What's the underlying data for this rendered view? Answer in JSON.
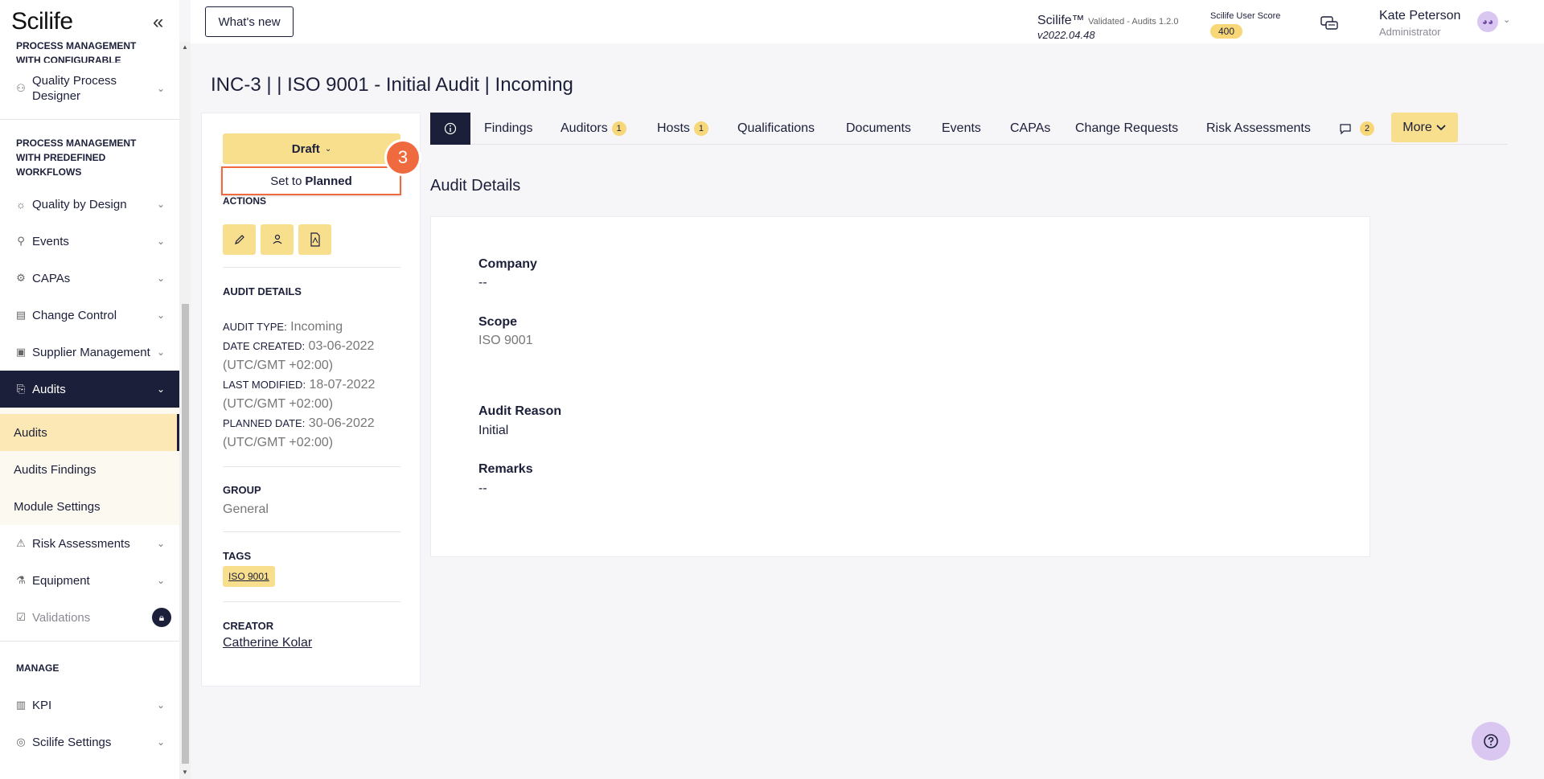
{
  "app": {
    "logo": "Scilife"
  },
  "topbar": {
    "whats_new": "What's new",
    "product": "Scilife™",
    "validated": "Validated - Audits 1.2.0",
    "version": "v2022.04.48",
    "score_label": "Scilife User Score",
    "score_value": "400",
    "user_name": "Kate Peterson",
    "user_role": "Administrator"
  },
  "sidebar": {
    "section_configurable": "PROCESS MANAGEMENT WITH CONFIGURABLE WORKFLOWS",
    "quality_process_designer": "Quality Process Designer",
    "section_predefined": "PROCESS MANAGEMENT WITH PREDEFINED WORKFLOWS",
    "items": [
      {
        "label": "Quality by Design",
        "icon": "lightbulb-icon"
      },
      {
        "label": "Events",
        "icon": "pin-icon"
      },
      {
        "label": "CAPAs",
        "icon": "capa-icon"
      },
      {
        "label": "Change Control",
        "icon": "change-icon"
      },
      {
        "label": "Supplier Management",
        "icon": "box-icon"
      },
      {
        "label": "Audits",
        "icon": "audit-icon"
      }
    ],
    "subitems": [
      "Audits",
      "Audits Findings",
      "Module Settings"
    ],
    "items2": [
      {
        "label": "Risk Assessments",
        "icon": "warning-icon"
      },
      {
        "label": "Equipment",
        "icon": "flask-icon"
      },
      {
        "label": "Validations",
        "icon": "clipboard-icon"
      }
    ],
    "section_manage": "MANAGE",
    "manage_items": [
      {
        "label": "KPI",
        "icon": "chart-icon"
      },
      {
        "label": "Scilife Settings",
        "icon": "settings-icon"
      }
    ]
  },
  "page": {
    "title": "INC-3 |  |  ISO 9001 - Initial Audit |  Incoming"
  },
  "left_panel": {
    "status_button": "Draft",
    "step_badge": "3",
    "set_to": "Set to",
    "set_to_state": "Planned",
    "actions_label": "ACTIONS",
    "audit_details_heading": "AUDIT DETAILS",
    "audit_type_label": "AUDIT TYPE:",
    "audit_type": "Incoming",
    "date_created_label": "DATE CREATED:",
    "date_created": "03-06-2022 (UTC/GMT +02:00)",
    "last_modified_label": "LAST MODIFIED:",
    "last_modified": "18-07-2022 (UTC/GMT +02:00)",
    "planned_date_label": "PLANNED DATE:",
    "planned_date": "30-06-2022 (UTC/GMT +02:00)",
    "group_heading": "GROUP",
    "group": "General",
    "tags_heading": "TAGS",
    "tag": "ISO 9001",
    "creator_heading": "CREATOR",
    "creator": "Catherine Kolar"
  },
  "tabs": {
    "findings": "Findings",
    "auditors": "Auditors",
    "auditors_count": "1",
    "hosts": "Hosts",
    "hosts_count": "1",
    "qualifications": "Qualifications",
    "documents": "Documents",
    "events": "Events",
    "capas": "CAPAs",
    "change_requests": "Change Requests",
    "risk_assessments": "Risk Assessments",
    "comments_count": "2",
    "more": "More"
  },
  "details": {
    "section_title": "Audit Details",
    "company_label": "Company",
    "company_value": "--",
    "scope_label": "Scope",
    "scope_value": "ISO 9001",
    "reason_label": "Audit Reason",
    "reason_value": "Initial",
    "remarks_label": "Remarks",
    "remarks_value": "--"
  },
  "colors": {
    "navy": "#1c1f3a",
    "accent_yellow": "#f8df8e",
    "highlight_orange": "#ef6b3f",
    "lavender": "#d9c7f2"
  }
}
